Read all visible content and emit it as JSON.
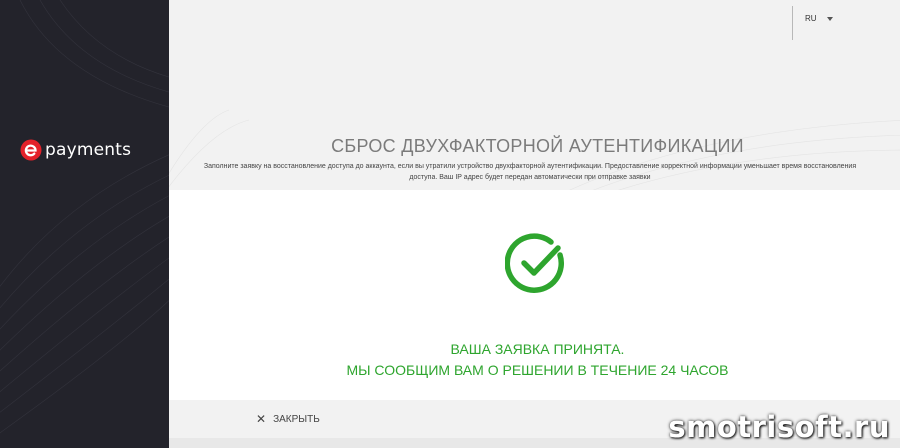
{
  "brand": {
    "name": "payments",
    "accent": "#e3212a",
    "sidebar_bg": "#23232b"
  },
  "header": {
    "language": "RU"
  },
  "main": {
    "title": "СБРОС ДВУХФАКТОРНОЙ АУТЕНТИФИКАЦИИ",
    "description": "Заполните заявку на восстановление доступа до аккаунта, если вы утратили устройство двухфакторной аутентификации. Предоставление корректной информации уменьшает время восстановления доступа. Ваш IP адрес будет передан автоматически при отправке заявки"
  },
  "result": {
    "icon": "checkmark-circle-icon",
    "line1": "ВАША ЗАЯВКА ПРИНЯТА.",
    "line2": "МЫ СООБЩИМ ВАМ О РЕШЕНИИ В ТЕЧЕНИЕ 24 ЧАСОВ",
    "color": "#2ea52e"
  },
  "footer": {
    "close_label": "ЗАКРЫТЬ"
  },
  "watermark": "smotrisoft.ru"
}
